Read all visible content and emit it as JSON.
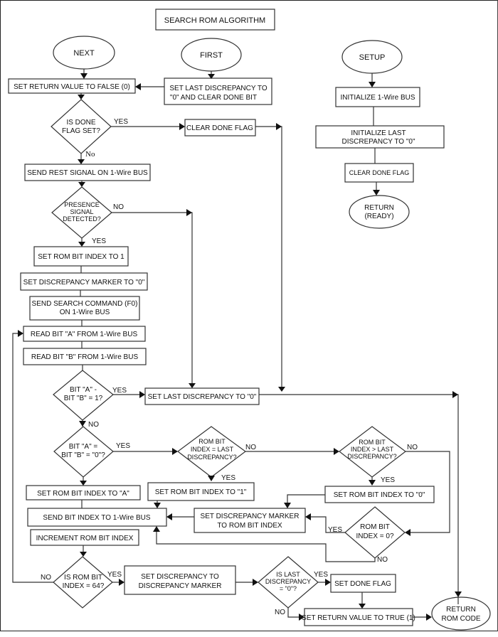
{
  "title": "SEARCH ROM ALGORITHM",
  "terminals": {
    "next": "NEXT",
    "first": "FIRST",
    "setup": "SETUP",
    "return_ready": [
      "RETURN",
      "(READY)"
    ],
    "return_rom_code": [
      "RETURN",
      "ROM CODE"
    ]
  },
  "process": {
    "set_return_false": [
      "SET RETURN VALUE TO FALSE (0)"
    ],
    "set_last_disc_clear_done": [
      "SET LAST DISCREPANCY TO",
      "\"0\" AND CLEAR DONE BIT"
    ],
    "clear_done_flag_main": [
      "CLEAR DONE FLAG"
    ],
    "send_reset": [
      "SEND REST SIGNAL ON 1-Wire BUS"
    ],
    "set_rom_bit_index_1": [
      "SET ROM BIT INDEX TO 1"
    ],
    "set_disc_marker_0": [
      "SET DISCREPANCY MARKER TO \"0\""
    ],
    "send_search_cmd": [
      "SEND SEARCH COMMAND (F0)",
      "ON 1-Wire BUS"
    ],
    "read_bit_a": [
      "READ BIT \"A\" FROM 1-Wire BUS"
    ],
    "read_bit_b": [
      "READ BIT \"B\" FROM 1-Wire BUS"
    ],
    "set_last_disc_0": [
      "SET LAST DISCREPANCY TO \"0\""
    ],
    "set_rom_bit_index_a": [
      "SET ROM BIT INDEX TO \"A\""
    ],
    "set_rom_bit_index_quote1": [
      "SET ROM BIT INDEX TO \"1\""
    ],
    "set_rom_bit_index_quote0": [
      "SET ROM BIT INDEX TO \"0\""
    ],
    "send_bit_index": [
      "SEND BIT INDEX TO 1-Wire BUS"
    ],
    "set_disc_marker_rom_bit": [
      "SET DISCREPANCY MARKER",
      "TO ROM BIT INDEX"
    ],
    "increment_rom_bit": [
      "INCREMENT ROM BIT INDEX"
    ],
    "set_disc_to_marker": [
      "SET DISCREPANCY TO",
      "DISCREPANCY MARKER"
    ],
    "set_done_flag": [
      "SET DONE FLAG"
    ],
    "set_return_true": [
      "SET RETURN VALUE TO TRUE (1)"
    ],
    "init_bus": [
      "INITIALIZE 1-Wire BUS"
    ],
    "init_last_disc": [
      "INITIALIZE LAST",
      "DISCREPANCY TO \"0\""
    ],
    "clear_done_flag_setup": [
      "CLEAR DONE FLAG"
    ]
  },
  "decisions": {
    "is_done_flag_set": [
      "IS DONE",
      "FLAG SET?"
    ],
    "presence_detected": [
      "PRESENCE",
      "SIGNAL",
      "DETECTED?"
    ],
    "bit_a_minus_b": [
      "BIT \"A\" -",
      "BIT \"B\" = 1?"
    ],
    "bit_a_eq_b_0": [
      "BIT \"A\" =",
      "BIT \"B\" = \"0\"?"
    ],
    "rom_bit_eq_last": [
      "ROM BIT",
      "INDEX = LAST",
      "DISCREPANCY?"
    ],
    "rom_bit_gt_last": [
      "ROM BIT",
      "INDEX > LAST",
      "DISCREPANCY?"
    ],
    "rom_bit_eq_0": [
      "ROM BIT",
      "INDEX = 0?"
    ],
    "rom_bit_eq_64": [
      "IS ROM BIT",
      "INDEX = 64?"
    ],
    "last_disc_eq_0": [
      "IS LAST",
      "DISCREPANCY",
      "= \"0\"?"
    ]
  },
  "labels": {
    "yes": "YES",
    "no": "NO",
    "no_mixed": "No"
  }
}
